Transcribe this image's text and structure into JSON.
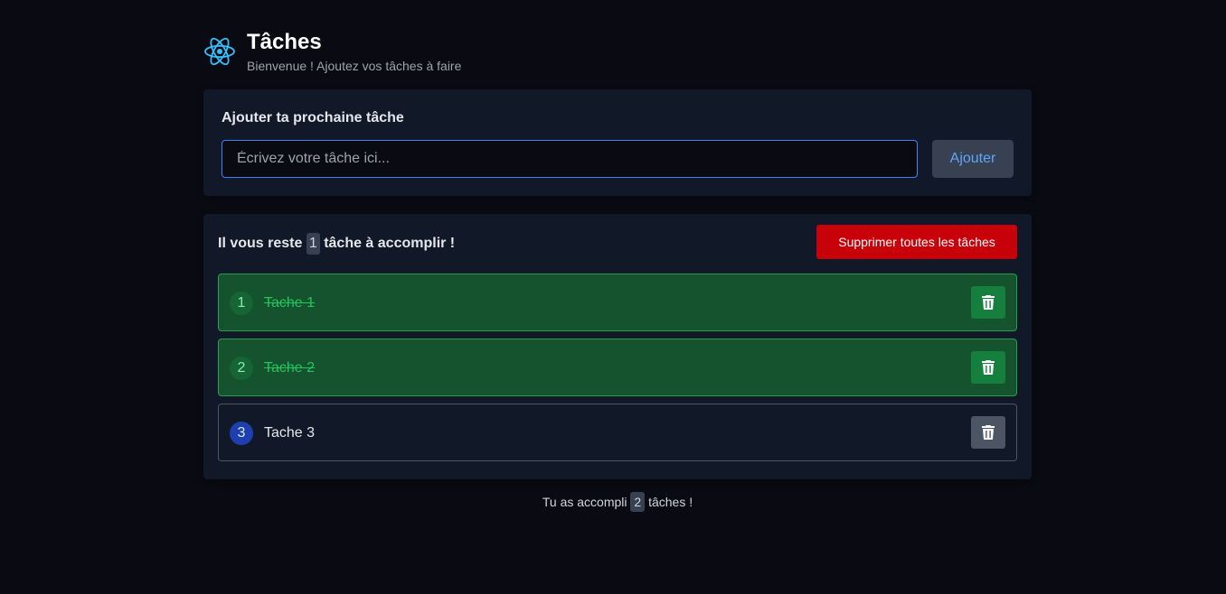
{
  "header": {
    "title": "Tâches",
    "subtitle": "Bienvenue ! Ajoutez vos tâches à faire",
    "logo_icon": "react-atom-icon",
    "logo_color": "#38bdf8"
  },
  "add_form": {
    "label": "Ajouter ta prochaine tâche",
    "input_value": "",
    "input_placeholder": "Écrivez votre tâche ici...",
    "button_label": "Ajouter"
  },
  "summary": {
    "remaining_prefix": "Il vous reste",
    "remaining_count": "1",
    "remaining_suffix": "tâche à accomplir !",
    "delete_all_label": "Supprimer toutes les tâches"
  },
  "tasks": [
    {
      "number": "1",
      "text": "Tache 1",
      "status": "done",
      "delete_icon": "trash-icon"
    },
    {
      "number": "2",
      "text": "Tache 2",
      "status": "done",
      "delete_icon": "trash-icon"
    },
    {
      "number": "3",
      "text": "Tache 3",
      "status": "pending",
      "delete_icon": "trash-icon"
    }
  ],
  "footer": {
    "prefix": "Tu as accompli",
    "count": "2",
    "suffix": "tâches !"
  },
  "colors": {
    "background": "#0a0b12",
    "card": "#111827",
    "done_bg": "#14532d",
    "done_border": "#22a04c",
    "pending_border": "#4b5563",
    "danger": "#c8000a",
    "accent": "#3b82f6"
  }
}
